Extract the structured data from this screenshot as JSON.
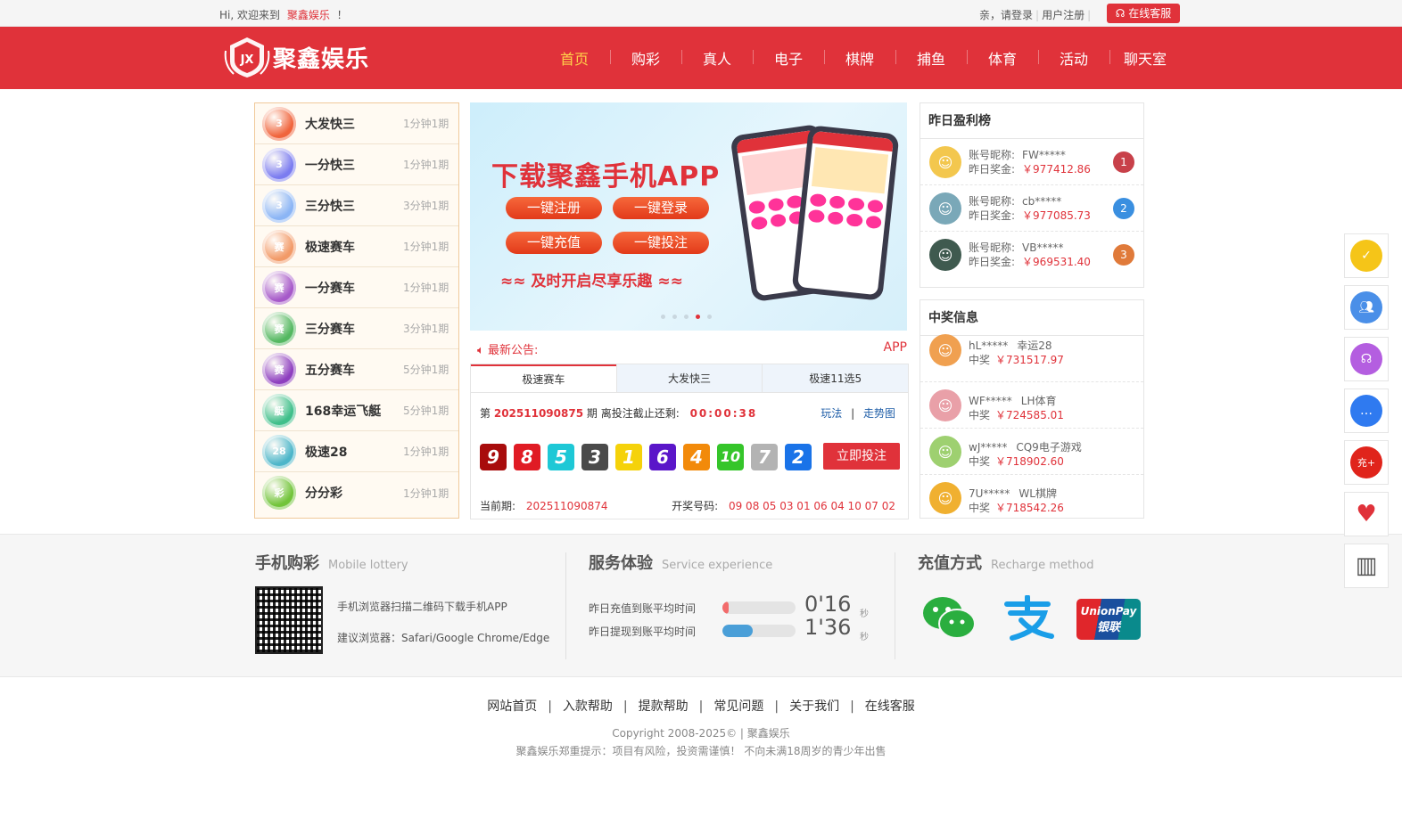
{
  "topbar": {
    "greeting_prefix": "Hi,  欢迎来到",
    "brand": "聚鑫娱乐",
    "greeting_suffix": "！",
    "login": "亲，请登录",
    "register": "用户注册",
    "service": "在线客服"
  },
  "header": {
    "logo_text": "聚鑫娱乐",
    "logo_badge": "JX",
    "nav": [
      "首页",
      "购彩",
      "真人",
      "电子",
      "棋牌",
      "捕鱼",
      "体育",
      "活动",
      "聊天室"
    ]
  },
  "lottery_list": [
    {
      "name": "大发快三",
      "period": "1分钟1期",
      "color": "#f0643c",
      "icon_label": "3"
    },
    {
      "name": "一分快三",
      "period": "1分钟1期",
      "color": "#7b7cf0",
      "icon_label": "3"
    },
    {
      "name": "三分快三",
      "period": "3分钟1期",
      "color": "#8bb5f5",
      "icon_label": "3"
    },
    {
      "name": "极速赛车",
      "period": "1分钟1期",
      "color": "#f29a68",
      "icon_label": "赛"
    },
    {
      "name": "一分赛车",
      "period": "1分钟1期",
      "color": "#a659c9",
      "icon_label": "赛"
    },
    {
      "name": "三分赛车",
      "period": "3分钟1期",
      "color": "#54b861",
      "icon_label": "赛"
    },
    {
      "name": "五分赛车",
      "period": "5分钟1期",
      "color": "#8e3fbf",
      "icon_label": "赛"
    },
    {
      "name": "168幸运飞艇",
      "period": "5分钟1期",
      "color": "#3fbf8a",
      "icon_label": "艇"
    },
    {
      "name": "极速28",
      "period": "1分钟1期",
      "color": "#4db6c9",
      "icon_label": "28"
    },
    {
      "name": "分分彩",
      "period": "1分钟1期",
      "color": "#72c43a",
      "icon_label": "彩"
    }
  ],
  "banner": {
    "title": "下载聚鑫手机APP",
    "buttons": [
      "一键注册",
      "一键登录",
      "一键充值",
      "一键投注"
    ],
    "slogan": "及时开启尽享乐趣",
    "slide_count": 5,
    "active_slide": 4
  },
  "notice": {
    "label": "最新公告:",
    "app": "APP"
  },
  "game": {
    "tabs": [
      "极速赛车",
      "大发快三",
      "极速11选5"
    ],
    "issue_prefix": "第",
    "issue": "202511090875",
    "issue_suffix": "期 离投注截止还剩:",
    "countdown": "00:00:38",
    "link_rules": "玩法",
    "link_sep": "|",
    "link_trend": "走势图",
    "balls": [
      {
        "n": "9",
        "color": "#a80c0c"
      },
      {
        "n": "8",
        "color": "#e01b24"
      },
      {
        "n": "5",
        "color": "#1ec8d6"
      },
      {
        "n": "3",
        "color": "#4a4a4a"
      },
      {
        "n": "1",
        "color": "#f5d20a"
      },
      {
        "n": "6",
        "color": "#5a16c9"
      },
      {
        "n": "4",
        "color": "#f28a0a"
      },
      {
        "n": "10",
        "color": "#35c52a"
      },
      {
        "n": "7",
        "color": "#b3b3b3"
      },
      {
        "n": "2",
        "color": "#1a73e8"
      }
    ],
    "bet_button": "立即投注",
    "current_label": "当前期:",
    "current_issue": "202511090874",
    "draw_label": "开奖号码:",
    "draw_numbers": "09 08 05 03 01 06 04 10 07 02"
  },
  "rank": {
    "title": "昨日盈利榜",
    "nick_label": "账号昵称:",
    "prize_label": "昨日奖金:",
    "items": [
      {
        "nick": "FW*****",
        "prize": "￥977412.86",
        "rank": "1",
        "medal_color": "#c8414a",
        "avatar_color": "#f3c74e"
      },
      {
        "nick": "cb*****",
        "prize": "￥977085.73",
        "rank": "2",
        "medal_color": "#3a8fe0",
        "avatar_color": "#7aa8b8"
      },
      {
        "nick": "VB*****",
        "prize": "￥969531.40",
        "rank": "3",
        "medal_color": "#e07a3a",
        "avatar_color": "#3f5a4f"
      }
    ]
  },
  "winners": {
    "title": "中奖信息",
    "prize_label": "中奖",
    "items": [
      {
        "nick": "hL*****",
        "game": "幸运28",
        "amount": "￥731517.97",
        "avatar_color": "#f0a050"
      },
      {
        "nick": "WF*****",
        "game": "LH体育",
        "amount": "￥724585.01",
        "avatar_color": "#e9a0a8"
      },
      {
        "nick": "wJ*****",
        "game": "CQ9电子游戏",
        "amount": "￥718902.60",
        "avatar_color": "#9ed070"
      },
      {
        "nick": "7U*****",
        "game": "WL棋牌",
        "amount": "￥718542.26",
        "avatar_color": "#f0b030"
      }
    ]
  },
  "footer": {
    "mobile": {
      "title": "手机购彩",
      "subtitle": "Mobile lottery",
      "line1": "手机浏览器扫描二维码下载手机APP",
      "line2": "建议浏览器：Safari/Google Chrome/Edge"
    },
    "service": {
      "title": "服务体验",
      "subtitle": "Service experience",
      "deposit_label": "昨日充值到账平均时间",
      "deposit_time": "0'16",
      "deposit_level": 0.08,
      "withdraw_label": "昨日提现到账平均时间",
      "withdraw_time": "1'36",
      "withdraw_level": 0.42,
      "unit": "秒"
    },
    "payment": {
      "title": "充值方式",
      "subtitle": "Recharge method",
      "methods": [
        "wechat-pay-icon",
        "alipay-icon",
        "unionpay-icon"
      ],
      "unionpay_text1": "UnionPay",
      "unionpay_text2": "银联"
    }
  },
  "bottom": {
    "links": [
      "网站首页",
      "入款帮助",
      "提款帮助",
      "常见问题",
      "关于我们",
      "在线客服"
    ],
    "sep": "|",
    "copyright": "Copyright 2008-2025© | 聚鑫娱乐",
    "warning": "聚鑫娱乐郑重提示：项目有风险，投资需谨慎！  不向未满18周岁的青少年出售"
  },
  "float_tools": [
    {
      "name": "checkin-icon",
      "color": "#f5c518"
    },
    {
      "name": "users-icon",
      "color": "#4a8fe8"
    },
    {
      "name": "headset-icon",
      "color": "#b45ee0"
    },
    {
      "name": "chat-icon",
      "color": "#2f7af0"
    },
    {
      "name": "recharge-icon",
      "color": "#e0241b",
      "label": "充+"
    },
    {
      "name": "gift-hands-icon",
      "color": "#e0323a"
    },
    {
      "name": "barcode-icon",
      "color": "#555555"
    }
  ]
}
